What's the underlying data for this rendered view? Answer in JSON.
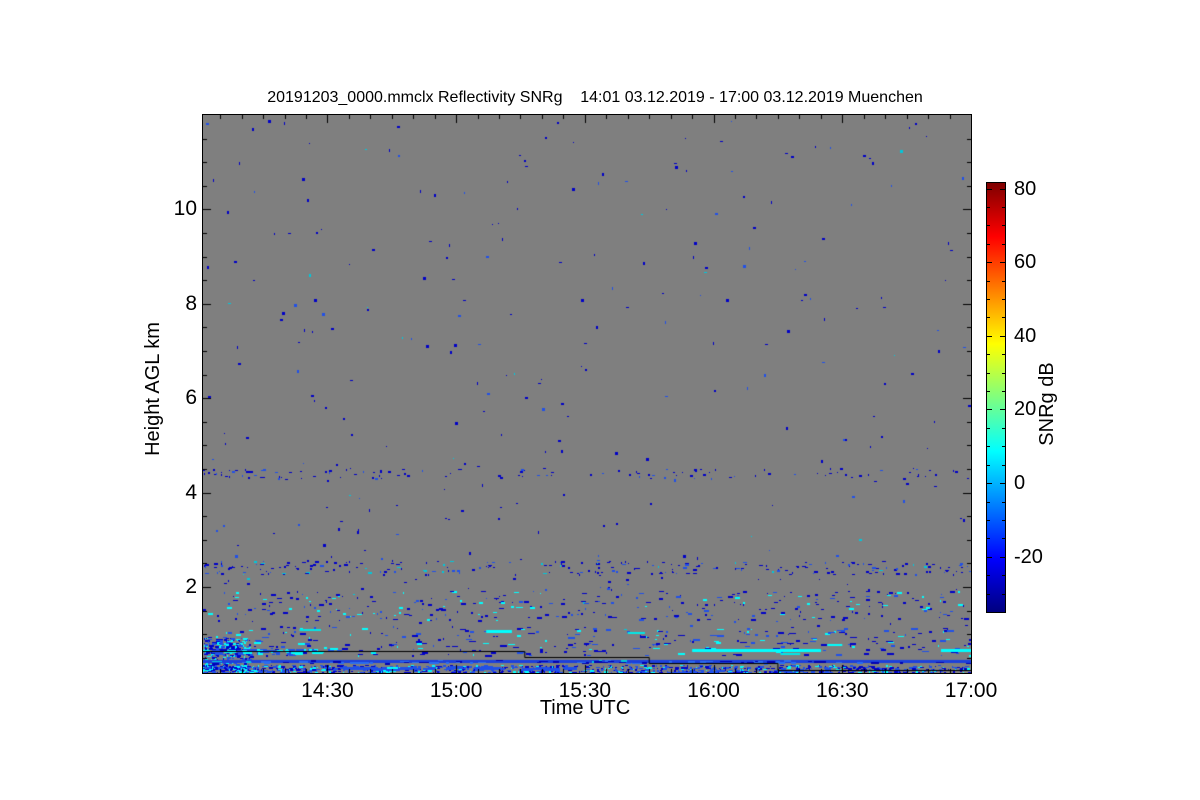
{
  "figure": {
    "background": "#ffffff"
  },
  "chart_data": {
    "type": "heatmap",
    "title": "20191203_0000.mmclx Reflectivity SNRg    14:01 03.12.2019 - 17:00 03.12.2019 Muenchen",
    "file": "20191203_0000.mmclx",
    "quantity": "Reflectivity SNRg",
    "time_start_label": "14:01 03.12.2019",
    "time_end_label": "17:00 03.12.2019",
    "station": "Muenchen",
    "xlabel": "Time UTC",
    "ylabel": "Height AGL km",
    "x_minutes_span": 179,
    "x_ticks": [
      {
        "t": 29,
        "label": "14:30"
      },
      {
        "t": 59,
        "label": "15:00"
      },
      {
        "t": 89,
        "label": "15:30"
      },
      {
        "t": 119,
        "label": "16:00"
      },
      {
        "t": 149,
        "label": "16:30"
      },
      {
        "t": 179,
        "label": "17:00"
      }
    ],
    "x_minor_step_min": 5,
    "y_km_range": [
      0.178,
      12.0
    ],
    "y_ticks": [
      {
        "h": 2,
        "label": "2"
      },
      {
        "h": 4,
        "label": "4"
      },
      {
        "h": 6,
        "label": "6"
      },
      {
        "h": 8,
        "label": "8"
      },
      {
        "h": 10,
        "label": "10"
      }
    ],
    "y_minor_step_km": 0.5,
    "no_signal_color": "#7f7f7f",
    "colorbar": {
      "label": "SNRg dB",
      "range_db": [
        -35,
        81.5
      ],
      "major_ticks": [
        80,
        60,
        40,
        20,
        0,
        -20
      ],
      "minor_step_db": 5,
      "colormap": "jet",
      "gradient": [
        [
          "#7f0000",
          0
        ],
        [
          "#ff0000",
          12.5
        ],
        [
          "#ffff00",
          37.5
        ],
        [
          "#7fff7f",
          50
        ],
        [
          "#00ffff",
          62.5
        ],
        [
          "#0000ff",
          87.5
        ],
        [
          "#00007f",
          100
        ]
      ]
    },
    "speckle_seed": 11,
    "features": [
      {
        "kind": "speckles",
        "name": "ambient-noise-upper",
        "t": [
          0,
          179
        ],
        "h": [
          2.6,
          11.92
        ],
        "count": 250,
        "w": [
          1,
          3
        ],
        "ht": [
          1,
          3
        ],
        "colors": [
          [
            "#0000c8",
            0.72
          ],
          [
            "#2050e8",
            0.22
          ],
          [
            "#00c8dc",
            0.06
          ]
        ]
      },
      {
        "kind": "speckles",
        "name": "ambient-noise-mid",
        "t": [
          0,
          179
        ],
        "h": [
          0.95,
          2.6
        ],
        "count": 150,
        "w": [
          1,
          3
        ],
        "ht": [
          1,
          2
        ],
        "colors": [
          [
            "#0000c8",
            0.7
          ],
          [
            "#2050e8",
            0.25
          ],
          [
            "#00c8dc",
            0.05
          ]
        ]
      },
      {
        "kind": "speckles",
        "name": "layer-4p4km",
        "t": [
          0,
          179
        ],
        "h": [
          4.3,
          4.52
        ],
        "count": 120,
        "w": [
          1,
          3
        ],
        "ht": [
          1,
          2
        ],
        "left_bias": 1.5,
        "colors": [
          [
            "#0000c8",
            0.78
          ],
          [
            "#2050e8",
            0.22
          ]
        ]
      },
      {
        "kind": "speckles",
        "name": "layer-2p4km",
        "t": [
          0,
          179
        ],
        "h": [
          2.27,
          2.56
        ],
        "count": 200,
        "w": [
          1,
          4
        ],
        "ht": [
          1,
          2
        ],
        "colors": [
          [
            "#0000c8",
            0.7
          ],
          [
            "#2050e8",
            0.22
          ],
          [
            "#00c8dc",
            0.08
          ]
        ]
      },
      {
        "kind": "speckles",
        "name": "layer-1p6km",
        "t": [
          0,
          179
        ],
        "h": [
          1.3,
          1.92
        ],
        "count": 260,
        "w": [
          1,
          5
        ],
        "ht": [
          1,
          2
        ],
        "colors": [
          [
            "#0000c8",
            0.6
          ],
          [
            "#2050e8",
            0.24
          ],
          [
            "#00ffff",
            0.16
          ]
        ]
      },
      {
        "kind": "speckles",
        "name": "layer-0p9km",
        "t": [
          0,
          179
        ],
        "h": [
          0.55,
          1.15
        ],
        "count": 300,
        "w": [
          1,
          7
        ],
        "ht": [
          1,
          2
        ],
        "colors": [
          [
            "#0000c8",
            0.5
          ],
          [
            "#2050e8",
            0.26
          ],
          [
            "#00ffff",
            0.24
          ]
        ]
      },
      {
        "kind": "speckles",
        "name": "left-dense-patch",
        "t": [
          0,
          11
        ],
        "h": [
          0.2,
          0.94
        ],
        "count": 330,
        "w": [
          1,
          4
        ],
        "ht": [
          1,
          2
        ],
        "colors": [
          [
            "#0000c8",
            0.38
          ],
          [
            "#2050e8",
            0.32
          ],
          [
            "#00ffff",
            0.3
          ]
        ]
      },
      {
        "kind": "speckles",
        "name": "cloudbase-cyan-dashes",
        "t": [
          0,
          30
        ],
        "h": [
          0.62,
          0.7
        ],
        "count": 55,
        "w": [
          3,
          9
        ],
        "ht": [
          2,
          3
        ],
        "colors": [
          [
            "#00ffff",
            0.5
          ],
          [
            "#2050e8",
            0.35
          ],
          [
            "#0000c8",
            0.15
          ]
        ]
      },
      {
        "kind": "rect",
        "name": "low-level-blue-band",
        "t": [
          0,
          179
        ],
        "h": [
          0.39,
          0.455
        ],
        "color": "#1c40dc"
      },
      {
        "kind": "speckles",
        "name": "blue-band-texture",
        "t": [
          0,
          179
        ],
        "h": [
          0.395,
          0.45
        ],
        "count": 70,
        "w": [
          3,
          10
        ],
        "ht": [
          1,
          2
        ],
        "colors": [
          [
            "#0000b4",
            0.5
          ],
          [
            "#2a6cf0",
            0.35
          ],
          [
            "#00c8dc",
            0.15
          ]
        ]
      },
      {
        "kind": "speckles",
        "name": "surface-clutter",
        "t": [
          0,
          179
        ],
        "h": [
          0.18,
          0.35
        ],
        "count": 1050,
        "w": [
          1,
          4
        ],
        "ht": [
          1,
          2
        ],
        "left_bias": 1.2,
        "colors": [
          [
            "#0000c8",
            0.44
          ],
          [
            "#2050e8",
            0.36
          ],
          [
            "#00ffff",
            0.2
          ]
        ]
      },
      {
        "kind": "speckles",
        "name": "clutter-dash-row",
        "t": [
          32,
          84
        ],
        "h": [
          0.285,
          0.32
        ],
        "count": 45,
        "w": [
          5,
          14
        ],
        "ht": [
          2,
          3
        ],
        "colors": [
          [
            "#2050e8",
            0.88
          ],
          [
            "#00ffff",
            0.12
          ]
        ]
      },
      {
        "kind": "speckles",
        "name": "clutter-dash-row-2",
        "t": [
          100,
          146
        ],
        "h": [
          0.2,
          0.24
        ],
        "count": 30,
        "w": [
          4,
          10
        ],
        "ht": [
          1,
          2
        ],
        "colors": [
          [
            "#2050e8",
            0.8
          ],
          [
            "#0000c8",
            0.2
          ]
        ]
      },
      {
        "kind": "segments",
        "name": "cyan-streaks",
        "segments": [
          [
            114,
            144,
            0.665,
            "#00ffff",
            3
          ],
          [
            172,
            179,
            0.665,
            "#00ffff",
            3
          ],
          [
            22.5,
            27.5,
            1.08,
            "#00e8e8",
            2
          ],
          [
            66,
            72,
            1.07,
            "#00ffff",
            3
          ],
          [
            99,
            103,
            1.02,
            "#00e8e8",
            2
          ],
          [
            145.5,
            149,
            0.78,
            "#00ffff",
            2
          ],
          [
            134.6,
            139.2,
            0.58,
            "#00e8e8",
            2
          ]
        ]
      },
      {
        "kind": "polyline",
        "name": "range-gate-step-line",
        "color": "#000000",
        "width": 1,
        "points": [
          [
            0,
            0.65
          ],
          [
            75,
            0.65
          ],
          [
            75,
            0.517
          ],
          [
            104,
            0.517
          ],
          [
            104,
            0.39
          ],
          [
            134,
            0.39
          ],
          [
            134,
            0.242
          ],
          [
            179,
            0.242
          ]
        ]
      }
    ]
  }
}
